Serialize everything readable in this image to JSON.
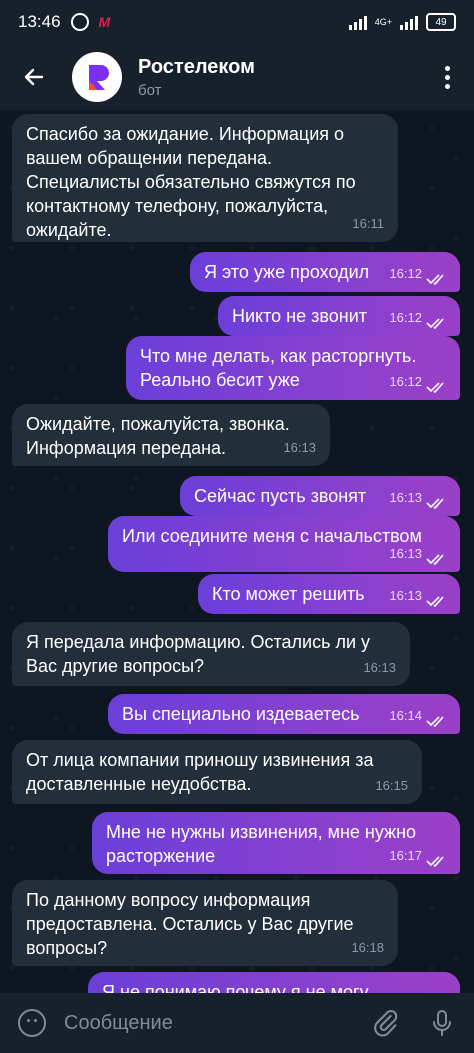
{
  "status": {
    "time": "13:46",
    "network": "4G+",
    "battery": "49"
  },
  "header": {
    "title": "Ростелеком",
    "subtitle": "бот"
  },
  "input": {
    "placeholder": "Сообщение"
  },
  "messages": [
    {
      "dir": "in",
      "text": "Спасибо за ожидание. Информация о вашем обращении передана. Специалисты обязательно свяжутся по контактному телефону, пожалуйста, ожидайте.",
      "time": "16:11"
    },
    {
      "dir": "out",
      "text": "Я это уже проходил",
      "time": "16:12"
    },
    {
      "dir": "out",
      "text": "Никто не звонит",
      "time": "16:12"
    },
    {
      "dir": "out",
      "text": "Что мне делать, как расторгнуть. Реально бесит уже",
      "time": "16:12"
    },
    {
      "dir": "in",
      "text": "Ожидайте, пожалуйста, звонка. Информация передана.",
      "time": "16:13"
    },
    {
      "dir": "out",
      "text": "Сейчас пусть звонят",
      "time": "16:13"
    },
    {
      "dir": "out",
      "text": "Или соедините меня с начальством",
      "time": "16:13"
    },
    {
      "dir": "out",
      "text": "Кто может решить",
      "time": "16:13"
    },
    {
      "dir": "in",
      "text": "Я передала информацию. Остались ли у Вас другие вопросы?",
      "time": "16:13"
    },
    {
      "dir": "out",
      "text": "Вы специально издеваетесь",
      "time": "16:14"
    },
    {
      "dir": "in",
      "text": "От лица компании приношу извинения за доставленные неудобства.",
      "time": "16:15"
    },
    {
      "dir": "out",
      "text": "Мне не нужны извинения, мне нужно расторжение",
      "time": "16:17"
    },
    {
      "dir": "in",
      "text": "По данному вопросу информация предоставлена. Остались у Вас другие вопросы?",
      "time": "16:18"
    },
    {
      "dir": "out",
      "text": "Я не понимаю почему я не могу",
      "time": ""
    }
  ]
}
